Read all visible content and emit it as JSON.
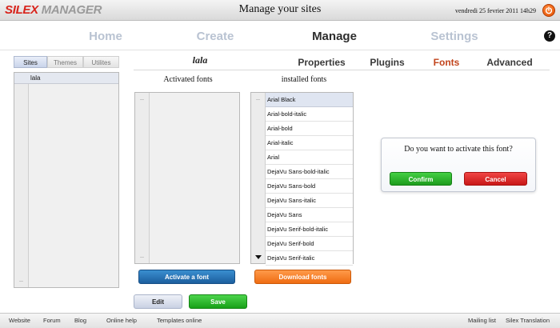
{
  "titlebar": {
    "logo_part1": "SILEX",
    "logo_part2": " MANAGER",
    "title": "Manage your sites",
    "date": "vendredi 25 fevrier 2011 14h29",
    "power_icon": "power-icon"
  },
  "nav": {
    "items": [
      {
        "label": "Home",
        "active": false
      },
      {
        "label": "Create",
        "active": false
      },
      {
        "label": "Manage",
        "active": true
      },
      {
        "label": "Settings",
        "active": false
      }
    ],
    "help_label": "?"
  },
  "left_tabs": [
    {
      "label": "Sites",
      "active": true
    },
    {
      "label": "Themes",
      "active": false
    },
    {
      "label": "Utilites",
      "active": false
    }
  ],
  "sites": [
    "lala"
  ],
  "site_name": "lala",
  "section_tabs": [
    {
      "label": "Properties",
      "active": false
    },
    {
      "label": "Plugins",
      "active": false
    },
    {
      "label": "Fonts",
      "active": true
    },
    {
      "label": "Advanced",
      "active": false
    }
  ],
  "fonts": {
    "activated_header": "Activated fonts",
    "installed_header": "installed fonts",
    "installed": [
      "Arial Black",
      "Arial-bold-italic",
      "Arial-bold",
      "Arial-italic",
      "Arial",
      "DejaVu Sans-bold-italic",
      "DejaVu Sans-bold",
      "DejaVu Sans-italic",
      "DejaVu Sans",
      "DejaVu Serif-bold-italic",
      "DejaVu Serif-bold",
      "DejaVu Serif-italic"
    ],
    "selected": "Arial Black",
    "activate_label": "Activate a font",
    "download_label": "Download fonts"
  },
  "actions": {
    "edit_label": "Edit",
    "save_label": "Save"
  },
  "dialog": {
    "message": "Do you want to activate this font?",
    "confirm_label": "Confirm",
    "cancel_label": "Cancel"
  },
  "footer": {
    "left_links": [
      "Website",
      "Forum",
      "Blog",
      "Online help",
      "Templates online"
    ],
    "right_links": [
      "Mailing list",
      "Silex Translation"
    ]
  },
  "colors": {
    "brand_red": "#d8231b",
    "active_tab": "#c2451d",
    "nav_inactive": "#b9c3d2"
  }
}
